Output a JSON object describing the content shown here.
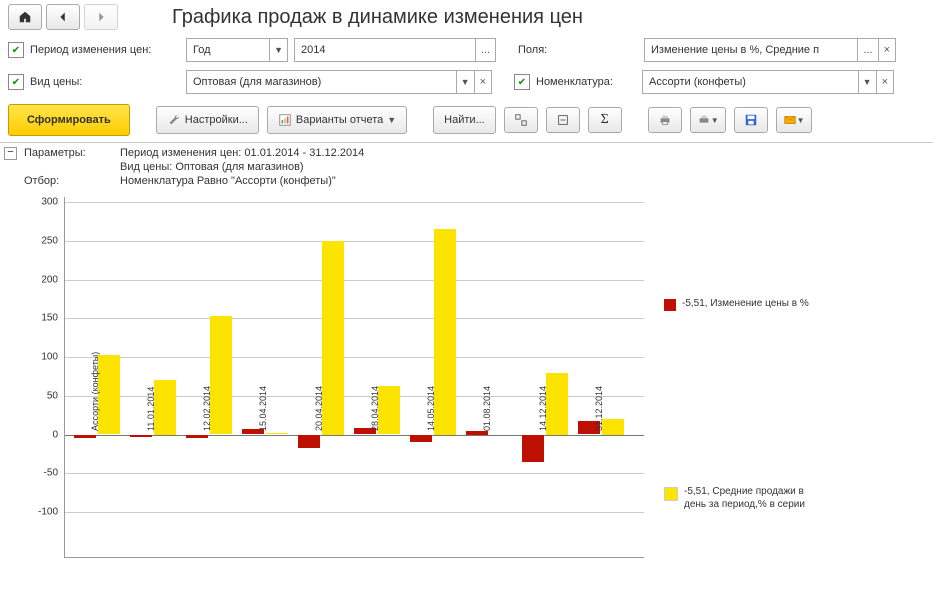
{
  "title": "Графика продаж в динамике изменения цен",
  "filters": {
    "period_label": "Период изменения цен:",
    "period_unit": "Год",
    "period_year": "2014",
    "fields_label": "Поля:",
    "fields_value": "Изменение цены в %, Средние п",
    "price_type_label": "Вид цены:",
    "price_type_value": "Оптовая (для магазинов)",
    "nomen_label": "Номенклатура:",
    "nomen_value": "Ассорти (конфеты)"
  },
  "toolbar": {
    "form": "Сформировать",
    "settings": "Настройки...",
    "variants": "Варианты отчета",
    "find": "Найти..."
  },
  "report": {
    "params_label": "Параметры:",
    "params_period": "Период изменения цен: 01.01.2014 - 31.12.2014",
    "params_price": "Вид цены: Оптовая (для магазинов)",
    "filter_label": "Отбор:",
    "filter_value": "Номенклатура Равно \"Ассорти (конфеты)\""
  },
  "legend": {
    "red": "-5,51, Изменение цены в %",
    "yellow": "-5,51, Средние продажи в день за период,% в серии"
  },
  "chart_data": {
    "type": "bar",
    "ylim": [
      -100,
      300
    ],
    "yticks": [
      -100,
      -50,
      0,
      50,
      100,
      150,
      200,
      250,
      300
    ],
    "categories": [
      "Ассорти (конфеты)",
      "11.01.2014",
      "12.02.2014",
      "15.04.2014",
      "20.04.2014",
      "28.04.2014",
      "14.05.2014",
      "01.08.2014",
      "14.12.2014",
      "31.12.2014"
    ],
    "series": [
      {
        "name": "Изменение цены в %",
        "color": "#be1001",
        "values": [
          -5,
          -3,
          -5,
          7,
          -18,
          8,
          -10,
          5,
          -35,
          18
        ]
      },
      {
        "name": "Средние продажи в день за период,% в серии",
        "color": "#fce300",
        "values": [
          102,
          70,
          153,
          2,
          250,
          63,
          265,
          0,
          80,
          20
        ]
      }
    ]
  }
}
